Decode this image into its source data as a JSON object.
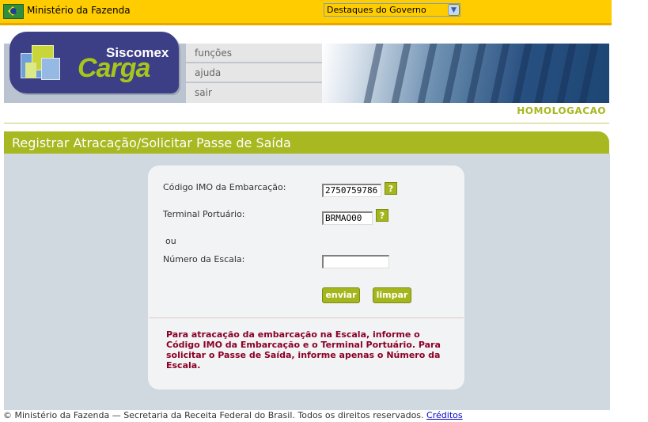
{
  "gov_bar": {
    "ministry": "Ministério da Fazenda",
    "highlights_select": "Destaques do Governo"
  },
  "logo": {
    "siscomex": "Siscomex",
    "carga": "Carga"
  },
  "menu": {
    "items": [
      "funções",
      "ajuda",
      "sair"
    ]
  },
  "environment": "HOMOLOGACAO",
  "page_title": "Registrar Atracação/Solicitar Passe de Saída",
  "form": {
    "imo_label": "Código IMO da Embarcação:",
    "imo_value": "2750759786",
    "terminal_label": "Terminal Portuário:",
    "terminal_value": "BRMAO00",
    "or_label": "ou",
    "scale_label": "Número da Escala:",
    "scale_value": "",
    "help_glyph": "?",
    "submit_label": "enviar",
    "clear_label": "limpar"
  },
  "info_text": "Para atracação da embarcação na Escala, informe o Código IMO da Embarcação e o Terminal Portuário. Para solicitar o Passe de Saída, informe apenas o Número da Escala.",
  "footer": {
    "copyright": "© Ministério da Fazenda — Secretaria da Receita Federal do Brasil. Todos os direitos reservados.",
    "credits": "Créditos"
  },
  "colors": {
    "gov_bar": "#ffcc00",
    "accent_green": "#a8b820",
    "logo_blue": "#3c3e86",
    "info_red": "#8b0026"
  },
  "icons": [
    "brazil-flag-icon",
    "dropdown-arrow-icon",
    "siscomex-cube-icon",
    "help-icon"
  ]
}
